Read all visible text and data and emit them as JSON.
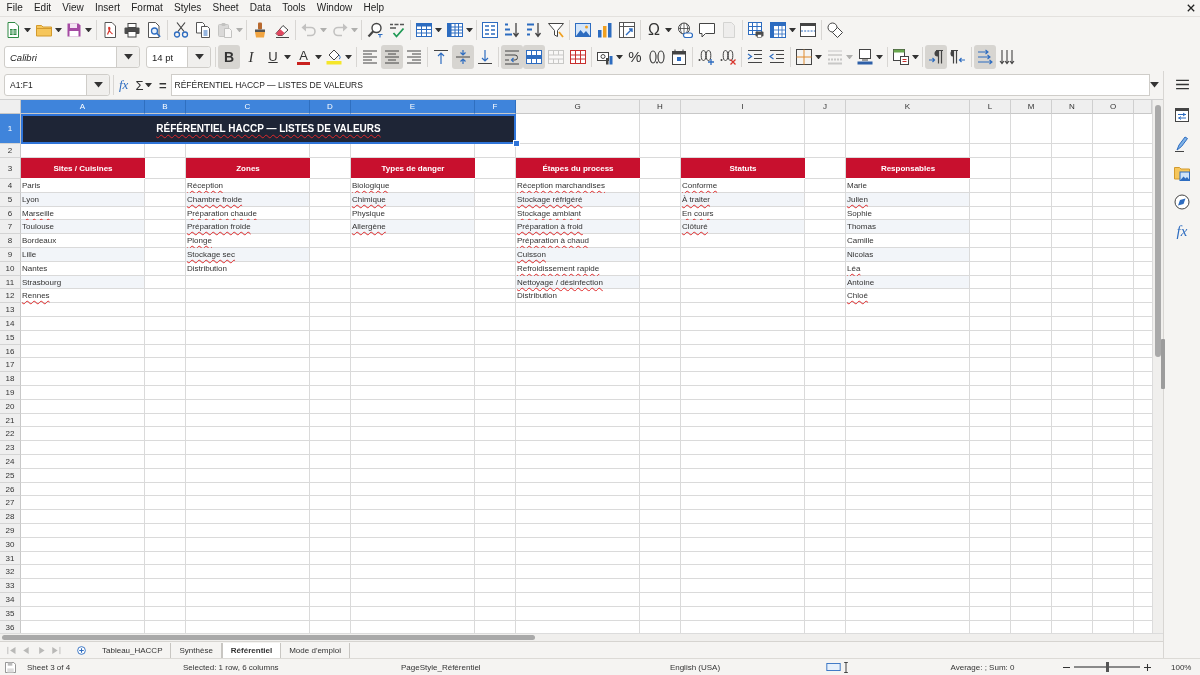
{
  "menu_bar": [
    "File",
    "Edit",
    "View",
    "Insert",
    "Format",
    "Styles",
    "Sheet",
    "Data",
    "Tools",
    "Window",
    "Help"
  ],
  "standard_toolbar": [
    [
      {
        "kind": "new",
        "dropdown": true,
        "disabled": false
      },
      {
        "kind": "open",
        "dropdown": true,
        "disabled": false
      },
      {
        "kind": "save",
        "dropdown": true,
        "disabled": false
      }
    ],
    [
      {
        "kind": "export_pdf",
        "dropdown": false,
        "disabled": false
      },
      {
        "kind": "print",
        "dropdown": false,
        "disabled": false
      },
      {
        "kind": "print_preview",
        "dropdown": false,
        "disabled": false
      }
    ],
    [
      {
        "kind": "cut",
        "dropdown": false,
        "disabled": false
      },
      {
        "kind": "copy",
        "dropdown": false,
        "disabled": false
      },
      {
        "kind": "paste",
        "dropdown": true,
        "disabled": true
      }
    ],
    [
      {
        "kind": "clone_formatting",
        "dropdown": false,
        "disabled": false
      },
      {
        "kind": "clear_formatting",
        "dropdown": false,
        "disabled": false
      }
    ],
    [
      {
        "kind": "undo",
        "dropdown": true,
        "disabled": true
      },
      {
        "kind": "redo",
        "dropdown": true,
        "disabled": true
      }
    ],
    [
      {
        "kind": "find_replace",
        "dropdown": false,
        "disabled": false
      },
      {
        "kind": "spelling",
        "dropdown": false,
        "disabled": false
      }
    ],
    [
      {
        "kind": "rows",
        "dropdown": true,
        "disabled": false
      },
      {
        "kind": "columns",
        "dropdown": true,
        "disabled": false
      }
    ],
    [
      {
        "kind": "sort",
        "dropdown": false,
        "disabled": false
      },
      {
        "kind": "sort_ascending",
        "dropdown": false,
        "disabled": false
      },
      {
        "kind": "sort_descending",
        "dropdown": false,
        "disabled": false
      },
      {
        "kind": "autofilter",
        "dropdown": false,
        "disabled": false
      }
    ],
    [
      {
        "kind": "image",
        "dropdown": false,
        "disabled": false
      },
      {
        "kind": "chart",
        "dropdown": false,
        "disabled": false
      },
      {
        "kind": "pivot_table",
        "dropdown": false,
        "disabled": false
      }
    ],
    [
      {
        "kind": "special_character",
        "label": "Ω",
        "dropdown": true,
        "disabled": false
      },
      {
        "kind": "hyperlink",
        "dropdown": false,
        "disabled": false
      },
      {
        "kind": "comment",
        "dropdown": false,
        "disabled": false
      },
      {
        "kind": "headers_footers",
        "dropdown": false,
        "disabled": true
      }
    ],
    [
      {
        "kind": "print_area",
        "dropdown": false,
        "disabled": false
      },
      {
        "kind": "freeze",
        "dropdown": true,
        "disabled": false
      },
      {
        "kind": "split_window",
        "dropdown": false,
        "disabled": false
      }
    ],
    [
      {
        "kind": "draw_functions",
        "dropdown": false,
        "disabled": false
      }
    ]
  ],
  "formatting_toolbar": {
    "font_name": {
      "value": "Calibri"
    },
    "font_size": {
      "value": "14 pt"
    },
    "groups": [
      [
        {
          "kind": "bold",
          "label": "B",
          "dropdown": false,
          "on": true,
          "disabled": false
        },
        {
          "kind": "italic",
          "label": "I",
          "dropdown": false,
          "on": false,
          "disabled": false
        },
        {
          "kind": "underline",
          "label": "U",
          "dropdown": true,
          "on": false,
          "disabled": false
        },
        {
          "kind": "font_color",
          "label": "A",
          "dropdown": true,
          "on": false,
          "disabled": false
        },
        {
          "kind": "highlighting",
          "dropdown": true,
          "on": false,
          "disabled": false
        }
      ],
      [
        {
          "kind": "align_left",
          "dropdown": false,
          "on": false,
          "disabled": false
        },
        {
          "kind": "align_center",
          "dropdown": false,
          "on": true,
          "disabled": false
        },
        {
          "kind": "align_right",
          "dropdown": false,
          "on": false,
          "disabled": false
        }
      ],
      [
        {
          "kind": "align_top",
          "dropdown": false,
          "on": false,
          "disabled": false
        },
        {
          "kind": "center_vertically",
          "dropdown": false,
          "on": true,
          "disabled": false
        },
        {
          "kind": "align_bottom",
          "dropdown": false,
          "on": false,
          "disabled": false
        }
      ],
      [
        {
          "kind": "wrap_text",
          "dropdown": false,
          "on": true,
          "disabled": false
        },
        {
          "kind": "merge_center",
          "dropdown": false,
          "on": true,
          "disabled": false
        },
        {
          "kind": "merge_cells",
          "dropdown": false,
          "on": false,
          "disabled": true
        },
        {
          "kind": "unmerge_cells",
          "dropdown": false,
          "on": false,
          "disabled": false
        }
      ],
      [
        {
          "kind": "currency",
          "dropdown": true,
          "on": false,
          "disabled": false
        },
        {
          "kind": "percent",
          "label": "%",
          "dropdown": false,
          "on": false,
          "disabled": false
        },
        {
          "kind": "number",
          "dropdown": false,
          "on": false,
          "disabled": false
        },
        {
          "kind": "date",
          "dropdown": false,
          "on": false,
          "disabled": false
        }
      ],
      [
        {
          "kind": "add_decimal",
          "dropdown": false,
          "on": false,
          "disabled": false
        },
        {
          "kind": "delete_decimal",
          "dropdown": false,
          "on": false,
          "disabled": false
        }
      ],
      [
        {
          "kind": "increase_indent",
          "dropdown": false,
          "on": false,
          "disabled": false
        },
        {
          "kind": "decrease_indent",
          "dropdown": false,
          "on": false,
          "disabled": false
        }
      ],
      [
        {
          "kind": "borders",
          "dropdown": true,
          "on": false,
          "disabled": false
        },
        {
          "kind": "border_style",
          "dropdown": true,
          "on": false,
          "disabled": true
        },
        {
          "kind": "border_color",
          "dropdown": true,
          "on": false,
          "disabled": false
        }
      ],
      [
        {
          "kind": "conditional",
          "dropdown": true,
          "on": false,
          "disabled": false
        }
      ],
      [
        {
          "kind": "left_to_right",
          "dropdown": false,
          "on": true,
          "disabled": false
        },
        {
          "kind": "right_to_left",
          "dropdown": false,
          "on": false,
          "disabled": false
        }
      ],
      [
        {
          "kind": "text_left_to_right",
          "dropdown": false,
          "on": true,
          "disabled": false
        },
        {
          "kind": "text_top_to_bottom",
          "dropdown": false,
          "on": false,
          "disabled": false
        }
      ]
    ]
  },
  "formula_bar": {
    "name_box": "A1:F1",
    "function_wizard": "fx",
    "sum": "Σ",
    "formula": "=",
    "content": "RÉFÉRENTIEL HACCP — LISTES DE VALEURS"
  },
  "sheet": {
    "columns": [
      {
        "label": "A",
        "selected": true
      },
      {
        "label": "B",
        "selected": true
      },
      {
        "label": "C",
        "selected": true
      },
      {
        "label": "D",
        "selected": true
      },
      {
        "label": "E",
        "selected": true
      },
      {
        "label": "F",
        "selected": true
      },
      {
        "label": "G",
        "selected": false
      },
      {
        "label": "H",
        "selected": false
      },
      {
        "label": "I",
        "selected": false
      },
      {
        "label": "J",
        "selected": false
      },
      {
        "label": "K",
        "selected": false
      },
      {
        "label": "L",
        "selected": false
      },
      {
        "label": "M",
        "selected": false
      },
      {
        "label": "N",
        "selected": false
      },
      {
        "label": "O",
        "selected": false
      }
    ],
    "rows": [
      {
        "label": "1",
        "selected": true
      },
      {
        "label": "2",
        "selected": false
      },
      {
        "label": "3",
        "selected": false
      },
      {
        "label": "4",
        "selected": false
      },
      {
        "label": "5",
        "selected": false
      },
      {
        "label": "6",
        "selected": false
      },
      {
        "label": "7",
        "selected": false
      },
      {
        "label": "8",
        "selected": false
      },
      {
        "label": "9",
        "selected": false
      },
      {
        "label": "10",
        "selected": false
      },
      {
        "label": "11",
        "selected": false
      },
      {
        "label": "12",
        "selected": false
      },
      {
        "label": "13",
        "selected": false
      },
      {
        "label": "14",
        "selected": false
      },
      {
        "label": "15",
        "selected": false
      },
      {
        "label": "16",
        "selected": false
      },
      {
        "label": "17",
        "selected": false
      },
      {
        "label": "18",
        "selected": false
      },
      {
        "label": "19",
        "selected": false
      },
      {
        "label": "20",
        "selected": false
      },
      {
        "label": "21",
        "selected": false
      },
      {
        "label": "22",
        "selected": false
      },
      {
        "label": "23",
        "selected": false
      },
      {
        "label": "24",
        "selected": false
      },
      {
        "label": "25",
        "selected": false
      },
      {
        "label": "26",
        "selected": false
      },
      {
        "label": "27",
        "selected": false
      },
      {
        "label": "28",
        "selected": false
      },
      {
        "label": "29",
        "selected": false
      },
      {
        "label": "30",
        "selected": false
      },
      {
        "label": "31",
        "selected": false
      },
      {
        "label": "32",
        "selected": false
      },
      {
        "label": "33",
        "selected": false
      },
      {
        "label": "34",
        "selected": false
      },
      {
        "label": "35",
        "selected": false
      },
      {
        "label": "36",
        "selected": false
      }
    ],
    "title": {
      "text": "RÉFÉRENTIEL HACCP — LISTES DE VALEURS",
      "selected": true,
      "spell_error": true
    },
    "lists": [
      {
        "header": "Sites / Cuisines",
        "items": [
          {
            "text": "Paris",
            "spell_error": false
          },
          {
            "text": "Lyon",
            "spell_error": false
          },
          {
            "text": "Marseille",
            "spell_error": true
          },
          {
            "text": "Toulouse",
            "spell_error": false
          },
          {
            "text": "Bordeaux",
            "spell_error": false
          },
          {
            "text": "Lille",
            "spell_error": false
          },
          {
            "text": "Nantes",
            "spell_error": false
          },
          {
            "text": "Strasbourg",
            "spell_error": false
          },
          {
            "text": "Rennes",
            "spell_error": true
          }
        ]
      },
      {
        "header": "Zones",
        "items": [
          {
            "text": "Réception",
            "spell_error": true
          },
          {
            "text": "Chambre froide",
            "spell_error": true
          },
          {
            "text": "Préparation chaude",
            "spell_error": true
          },
          {
            "text": "Préparation froide",
            "spell_error": true
          },
          {
            "text": "Plonge",
            "spell_error": true
          },
          {
            "text": "Stockage sec",
            "spell_error": true
          },
          {
            "text": "Distribution",
            "spell_error": false
          }
        ]
      },
      {
        "header": "Types de danger",
        "items": [
          {
            "text": "Biologique",
            "spell_error": true
          },
          {
            "text": "Chimique",
            "spell_error": true
          },
          {
            "text": "Physique",
            "spell_error": false
          },
          {
            "text": "Allergène",
            "spell_error": true
          }
        ]
      },
      {
        "header": "Étapes du process",
        "items": [
          {
            "text": "Réception marchandises",
            "spell_error": true
          },
          {
            "text": "Stockage réfrigéré",
            "spell_error": true
          },
          {
            "text": "Stockage ambiant",
            "spell_error": true
          },
          {
            "text": "Préparation à froid",
            "spell_error": true
          },
          {
            "text": "Préparation à chaud",
            "spell_error": true
          },
          {
            "text": "Cuisson",
            "spell_error": true
          },
          {
            "text": "Refroidissement rapide",
            "spell_error": true
          },
          {
            "text": "Nettoyage / désinfection",
            "spell_error": true
          },
          {
            "text": "Distribution",
            "spell_error": false
          }
        ]
      },
      {
        "header": "Statuts",
        "items": [
          {
            "text": "Conforme",
            "spell_error": true
          },
          {
            "text": "À traiter",
            "spell_error": true
          },
          {
            "text": "En cours",
            "spell_error": true
          },
          {
            "text": "Clôturé",
            "spell_error": true
          }
        ]
      },
      {
        "header": "Responsables",
        "items": [
          {
            "text": "Marie",
            "spell_error": false
          },
          {
            "text": "Julien",
            "spell_error": true
          },
          {
            "text": "Sophie",
            "spell_error": false
          },
          {
            "text": "Thomas",
            "spell_error": false
          },
          {
            "text": "Camille",
            "spell_error": false
          },
          {
            "text": "Nicolas",
            "spell_error": false
          },
          {
            "text": "Léa",
            "spell_error": true
          },
          {
            "text": "Antoine",
            "spell_error": false
          },
          {
            "text": "Chloé",
            "spell_error": true
          }
        ]
      }
    ]
  },
  "sheet_tabs": {
    "navigation": [
      {
        "kind": "first",
        "disabled": true
      },
      {
        "kind": "previous",
        "disabled": true
      },
      {
        "kind": "next",
        "disabled": true
      },
      {
        "kind": "last",
        "disabled": true
      }
    ],
    "tabs": [
      {
        "label": "Tableau_HACCP",
        "selected": false
      },
      {
        "label": "Synthèse",
        "selected": false
      },
      {
        "label": "Référentiel",
        "selected": true
      },
      {
        "label": "Mode d'emploi",
        "selected": false
      }
    ]
  },
  "sidebar": [
    {
      "kind": "properties"
    },
    {
      "kind": "styles"
    },
    {
      "kind": "gallery"
    },
    {
      "kind": "navigator"
    },
    {
      "kind": "functions",
      "label": "fx"
    }
  ],
  "status_bar": {
    "sheet": "Sheet 3 of 4",
    "selection": "Selected: 1 row, 6 columns",
    "page_style": "PageStyle_Référentiel",
    "language": "English (USA)",
    "sum": "Average: ; Sum: 0",
    "zoom": {
      "level": 0.5,
      "reading": "100%"
    }
  }
}
